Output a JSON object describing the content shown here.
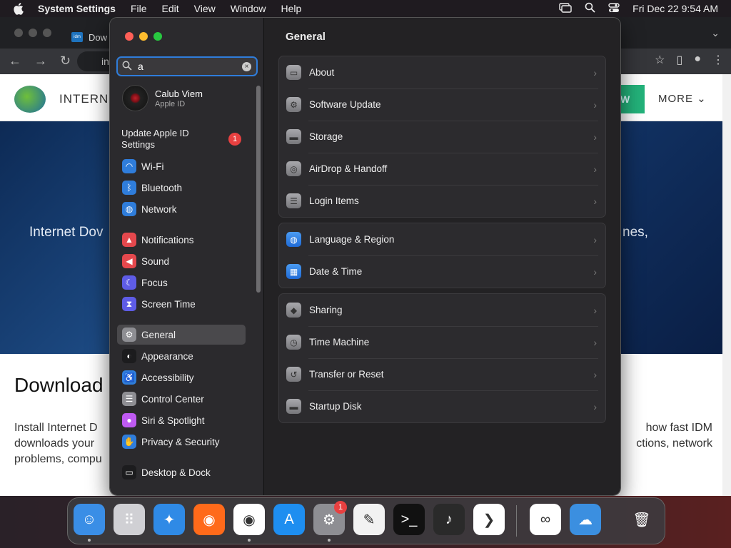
{
  "menubar": {
    "app": "System Settings",
    "items": [
      "File",
      "Edit",
      "View",
      "Window",
      "Help"
    ],
    "clock": "Fri Dec 22  9:54 AM"
  },
  "browser": {
    "tab_label": "Dow",
    "url_text": "in",
    "brand": "INTERNET",
    "download_btn": "W",
    "more": "MORE",
    "hero_left": "Internet Dov",
    "hero_right": "nes,",
    "download_title": "Download",
    "para_left": "Install Internet D downloads your problems, compu",
    "para_right": "how fast IDM ctions, network"
  },
  "settings": {
    "search": {
      "value": "a"
    },
    "user": {
      "name": "Calub Viem",
      "sub": "Apple ID"
    },
    "update": {
      "label": "Update Apple ID Settings",
      "badge": "1"
    },
    "sidebar": [
      {
        "label": "Wi-Fi",
        "color": "#2f7ddb",
        "icon": "wifi-icon",
        "glyph": "◠"
      },
      {
        "label": "Bluetooth",
        "color": "#2f7ddb",
        "icon": "bluetooth-icon",
        "glyph": "ᛒ"
      },
      {
        "label": "Network",
        "color": "#2f7ddb",
        "icon": "globe-icon",
        "glyph": "◍"
      },
      {
        "label": "Notifications",
        "color": "#e5484d",
        "icon": "bell-icon",
        "glyph": "▲"
      },
      {
        "label": "Sound",
        "color": "#e5484d",
        "icon": "speaker-icon",
        "glyph": "◀"
      },
      {
        "label": "Focus",
        "color": "#5e5ce6",
        "icon": "moon-icon",
        "glyph": "☾"
      },
      {
        "label": "Screen Time",
        "color": "#5e5ce6",
        "icon": "hourglass-icon",
        "glyph": "⧗"
      },
      {
        "label": "General",
        "color": "#8e8e93",
        "icon": "gear-icon",
        "glyph": "⚙"
      },
      {
        "label": "Appearance",
        "color": "#1c1c1e",
        "icon": "appearance-icon",
        "glyph": "◐"
      },
      {
        "label": "Accessibility",
        "color": "#2f7ddb",
        "icon": "accessibility-icon",
        "glyph": "♿"
      },
      {
        "label": "Control Center",
        "color": "#8e8e93",
        "icon": "control-center-icon",
        "glyph": "☰"
      },
      {
        "label": "Siri & Spotlight",
        "color": "#bf5af2",
        "icon": "siri-icon",
        "glyph": "●"
      },
      {
        "label": "Privacy & Security",
        "color": "#2f7ddb",
        "icon": "hand-icon",
        "glyph": "✋"
      },
      {
        "label": "Desktop & Dock",
        "color": "#1c1c1e",
        "icon": "dock-icon",
        "glyph": "▭"
      }
    ],
    "title": "General",
    "groups": [
      [
        {
          "label": "About",
          "icon": "computer-icon",
          "glyph": "▭",
          "tint": "gray"
        },
        {
          "label": "Software Update",
          "icon": "gear-badge-icon",
          "glyph": "⚙",
          "tint": "gray"
        },
        {
          "label": "Storage",
          "icon": "drive-icon",
          "glyph": "▬",
          "tint": "gray"
        },
        {
          "label": "AirDrop & Handoff",
          "icon": "airdrop-icon",
          "glyph": "◎",
          "tint": "gray"
        },
        {
          "label": "Login Items",
          "icon": "list-icon",
          "glyph": "☰",
          "tint": "gray"
        }
      ],
      [
        {
          "label": "Language & Region",
          "icon": "globe-icon",
          "glyph": "◍",
          "tint": "blue"
        },
        {
          "label": "Date & Time",
          "icon": "calendar-icon",
          "glyph": "▦",
          "tint": "blue"
        }
      ],
      [
        {
          "label": "Sharing",
          "icon": "sharing-icon",
          "glyph": "◆",
          "tint": "gray"
        },
        {
          "label": "Time Machine",
          "icon": "time-machine-icon",
          "glyph": "◷",
          "tint": "gray"
        },
        {
          "label": "Transfer or Reset",
          "icon": "reset-icon",
          "glyph": "↺",
          "tint": "gray"
        },
        {
          "label": "Startup Disk",
          "icon": "disk-icon",
          "glyph": "▬",
          "tint": "gray"
        }
      ]
    ]
  },
  "dock": {
    "apps": [
      {
        "name": "finder-icon",
        "color": "#3a8ee6",
        "glyph": "☺",
        "dot": true
      },
      {
        "name": "launchpad-icon",
        "color": "#d0d0d4",
        "glyph": "⠿",
        "dot": false
      },
      {
        "name": "safari-icon",
        "color": "#2f8ae6",
        "glyph": "✦",
        "dot": false
      },
      {
        "name": "firefox-icon",
        "color": "#ff6a1a",
        "glyph": "◉",
        "dot": false
      },
      {
        "name": "chrome-icon",
        "color": "#ffffff",
        "glyph": "◉",
        "dot": true
      },
      {
        "name": "app-store-icon",
        "color": "#1e8ef0",
        "glyph": "A",
        "dot": false
      },
      {
        "name": "system-settings-icon",
        "color": "#8e8e93",
        "glyph": "⚙",
        "dot": true
      },
      {
        "name": "textedit-icon",
        "color": "#f2f2f2",
        "glyph": "✎",
        "dot": false
      },
      {
        "name": "terminal-icon",
        "color": "#111111",
        "glyph": ">_",
        "dot": false
      },
      {
        "name": "garageband-icon",
        "color": "#2a2a2a",
        "glyph": "♪",
        "dot": false
      },
      {
        "name": "vscode-icon",
        "color": "#ffffff",
        "glyph": "❯",
        "dot": false
      },
      {
        "name": "visual-studio-icon",
        "color": "#ffffff",
        "glyph": "∞",
        "dot": false
      },
      {
        "name": "weather-icon",
        "color": "#3b8fe0",
        "glyph": "☁",
        "dot": false
      },
      {
        "name": "trash-icon",
        "color": "transparent",
        "glyph": "🗑",
        "dot": false
      }
    ],
    "settings_badge": "1"
  }
}
